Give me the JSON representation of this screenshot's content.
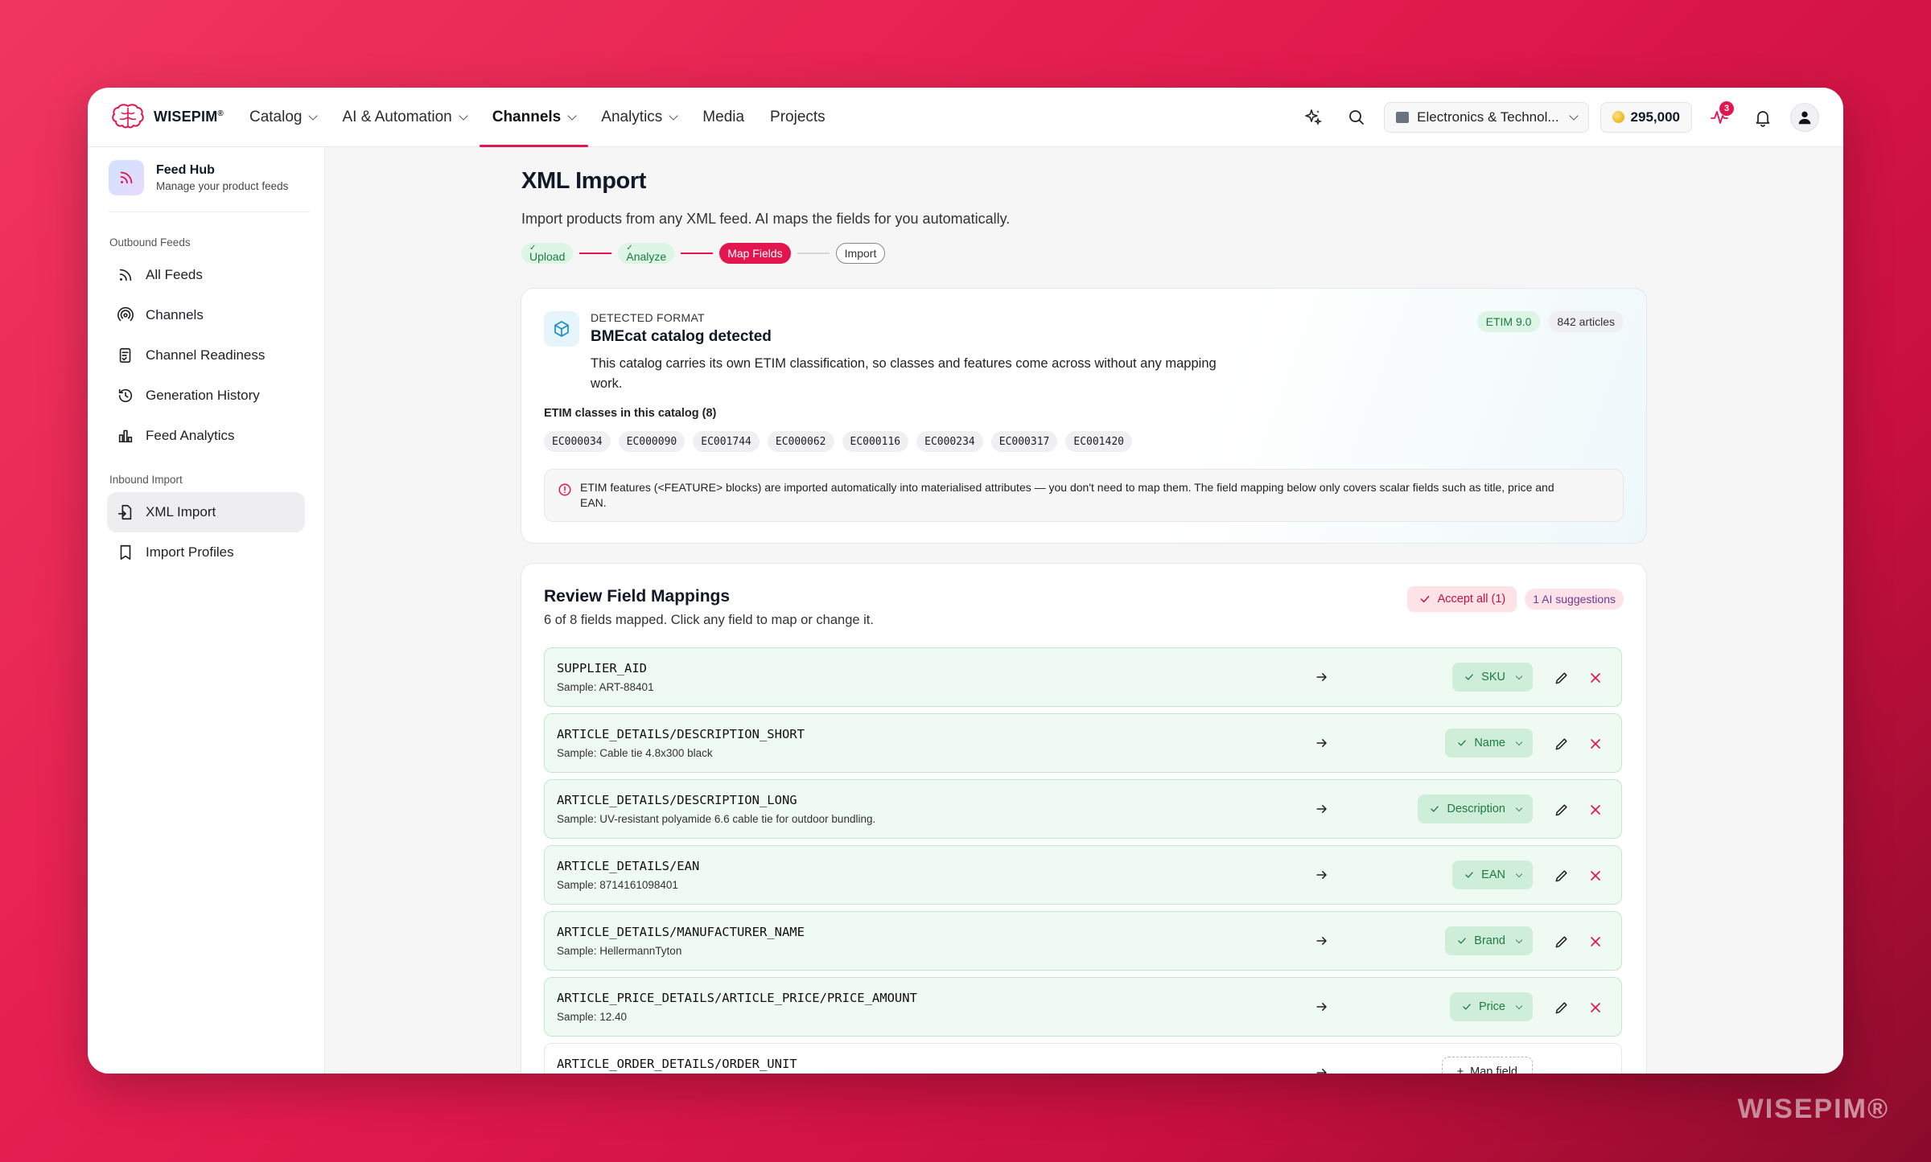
{
  "brand": {
    "name": "WISEPIM",
    "mark": "®",
    "watermark": "WISEPIM®",
    "accent": "#e3154f"
  },
  "nav": {
    "items": [
      {
        "label": "Catalog",
        "dropdown": true,
        "active": false
      },
      {
        "label": "AI & Automation",
        "dropdown": true,
        "active": false
      },
      {
        "label": "Channels",
        "dropdown": true,
        "active": true
      },
      {
        "label": "Analytics",
        "dropdown": true,
        "active": false
      },
      {
        "label": "Media",
        "dropdown": false,
        "active": false
      },
      {
        "label": "Projects",
        "dropdown": false,
        "active": false
      }
    ],
    "catalog_select": "Electronics & Technol...",
    "credits": "295,000",
    "activity_badge": "3"
  },
  "sidebar": {
    "hub_title": "Feed Hub",
    "hub_subtitle": "Manage your product feeds",
    "section_outbound": "Outbound Feeds",
    "outbound": [
      {
        "label": "All Feeds",
        "icon": "rss-icon"
      },
      {
        "label": "Channels",
        "icon": "broadcast-icon"
      },
      {
        "label": "Channel Readiness",
        "icon": "checklist-icon"
      },
      {
        "label": "Generation History",
        "icon": "history-icon"
      },
      {
        "label": "Feed Analytics",
        "icon": "bar-chart-icon"
      }
    ],
    "section_inbound": "Inbound Import",
    "inbound": [
      {
        "label": "XML Import",
        "icon": "file-import-icon",
        "active": true
      },
      {
        "label": "Import Profiles",
        "icon": "bookmark-icon",
        "active": false
      }
    ]
  },
  "page": {
    "title": "XML Import",
    "subtitle": "Import products from any XML feed. AI maps the fields for you automatically.",
    "steps": [
      {
        "label": "Upload",
        "state": "done"
      },
      {
        "label": "Analyze",
        "state": "done"
      },
      {
        "label": "Map Fields",
        "state": "current"
      },
      {
        "label": "Import",
        "state": "pending"
      }
    ]
  },
  "detected": {
    "label": "DETECTED FORMAT",
    "title": "BMEcat catalog detected",
    "description": "This catalog carries its own ETIM classification, so classes and features come across without any mapping work.",
    "badge_version": "ETIM 9.0",
    "badge_articles": "842 articles",
    "classes_label": "ETIM classes in this catalog (8)",
    "classes": [
      "EC000034",
      "EC000090",
      "EC001744",
      "EC000062",
      "EC000116",
      "EC000234",
      "EC000317",
      "EC001420"
    ],
    "info": "ETIM features (<FEATURE> blocks) are imported automatically into materialised attributes — you don't need to map them. The field mapping below only covers scalar fields such as title, price and EAN."
  },
  "review": {
    "title": "Review Field Mappings",
    "subtitle": "6 of 8 fields mapped. Click any field to map or change it.",
    "accept_all": "Accept all (1)",
    "ai_suggestions": "1 AI suggestions",
    "map_field_label": "Map field",
    "rows": [
      {
        "field": "SUPPLIER_AID",
        "sample": "Sample: ART-88401",
        "target": "SKU",
        "mapped": true
      },
      {
        "field": "ARTICLE_DETAILS/DESCRIPTION_SHORT",
        "sample": "Sample: Cable tie 4.8x300 black",
        "target": "Name",
        "mapped": true
      },
      {
        "field": "ARTICLE_DETAILS/DESCRIPTION_LONG",
        "sample": "Sample: UV-resistant polyamide 6.6 cable tie for outdoor bundling.",
        "target": "Description",
        "mapped": true
      },
      {
        "field": "ARTICLE_DETAILS/EAN",
        "sample": "Sample: 8714161098401",
        "target": "EAN",
        "mapped": true
      },
      {
        "field": "ARTICLE_DETAILS/MANUFACTURER_NAME",
        "sample": "Sample: HellermannTyton",
        "target": "Brand",
        "mapped": true
      },
      {
        "field": "ARTICLE_PRICE_DETAILS/ARTICLE_PRICE/PRICE_AMOUNT",
        "sample": "Sample: 12.40",
        "target": "Price",
        "mapped": true
      },
      {
        "field": "ARTICLE_ORDER_DETAILS/ORDER_UNIT",
        "sample": "",
        "target": "",
        "mapped": false
      }
    ]
  }
}
